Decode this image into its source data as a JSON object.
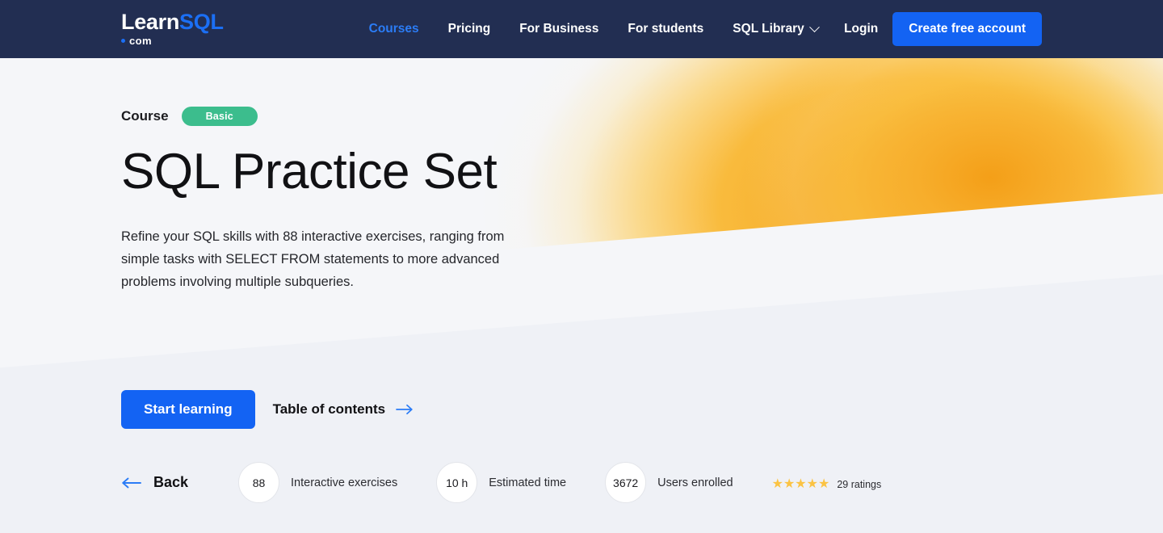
{
  "header": {
    "logo": {
      "learn": "Learn",
      "sql": "SQL",
      "com": "com"
    },
    "nav": [
      {
        "label": "Courses",
        "active": true,
        "has_chevron": false
      },
      {
        "label": "Pricing",
        "active": false,
        "has_chevron": false
      },
      {
        "label": "For Business",
        "active": false,
        "has_chevron": false
      },
      {
        "label": "For students",
        "active": false,
        "has_chevron": false
      },
      {
        "label": "SQL Library",
        "active": false,
        "has_chevron": true
      }
    ],
    "login_label": "Login",
    "cta_label": "Create free account",
    "background_color": "#222e52",
    "accent_color": "#1363f3"
  },
  "hero": {
    "course_label": "Course",
    "level_badge": "Basic",
    "level_badge_color": "#3cbd8d",
    "title": "SQL Practice Set",
    "description": "Refine your SQL skills with 88 interactive exercises, ranging from simple tasks with SELECT FROM statements to more advanced problems involving multiple subqueries.",
    "gradient_from": "#f5a623",
    "gradient_to": "#fbc85a"
  },
  "actions": {
    "start_label": "Start learning",
    "toc_label": "Table of contents",
    "toc_arrow_color": "#2b7cf6"
  },
  "stats": {
    "back_label": "Back",
    "back_arrow_color": "#2b7cf6",
    "items": [
      {
        "value": "88",
        "label": "Interactive exercises"
      },
      {
        "value": "10 h",
        "label": "Estimated time"
      },
      {
        "value": "3672",
        "label": "Users enrolled"
      }
    ],
    "rating": {
      "stars_filled": 5,
      "stars_total": 5,
      "star_color": "#fbc343",
      "ratings_label": "29 ratings"
    }
  }
}
